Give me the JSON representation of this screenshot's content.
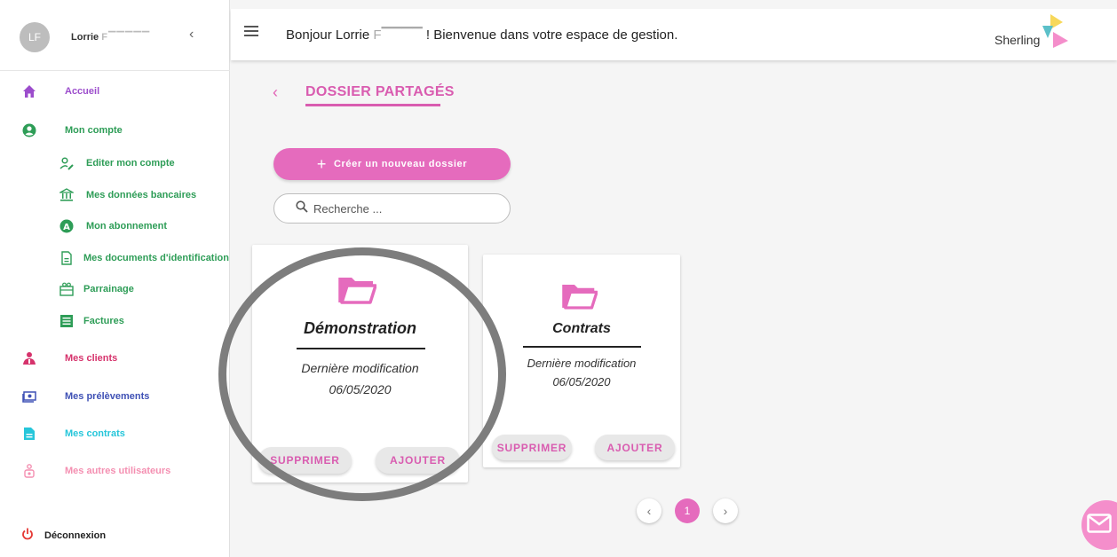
{
  "sidebar": {
    "avatar_initials": "LF",
    "user_first": "Lorrie",
    "user_last_redacted": "F▔▔▔▔▔",
    "collapse_icon": "chevron-left-icon",
    "items": [
      {
        "label": "Accueil",
        "icon": "home-icon",
        "color": "#9c4dcc"
      },
      {
        "label": "Mon compte",
        "icon": "account-circle-icon",
        "color": "#2e9d57"
      },
      {
        "label": "Editer mon compte",
        "icon": "user-edit-icon",
        "color": "#2e9d57"
      },
      {
        "label": "Mes données bancaires",
        "icon": "bank-icon",
        "color": "#2e9d57"
      },
      {
        "label": "Mon abonnement",
        "icon": "subscription-icon",
        "color": "#2e9d57"
      },
      {
        "label": "Mes documents d'identification",
        "icon": "document-icon",
        "color": "#2e9d57"
      },
      {
        "label": "Parrainage",
        "icon": "gift-icon",
        "color": "#2e9d57"
      },
      {
        "label": "Factures",
        "icon": "invoice-icon",
        "color": "#2e9d57"
      },
      {
        "label": "Mes clients",
        "icon": "clients-icon",
        "color": "#d6336c"
      },
      {
        "label": "Mes prélèvements",
        "icon": "payment-icon",
        "color": "#3f51b5"
      },
      {
        "label": "Mes contrats",
        "icon": "contract-icon",
        "color": "#26c6da"
      },
      {
        "label": "Mes autres utilisateurs",
        "icon": "users-icon",
        "color": "#f48fb1"
      }
    ],
    "logout_label": "Déconnexion"
  },
  "header": {
    "greeting_start": "Bonjour Lorrie ",
    "greeting_redacted": "F▔▔▔▔",
    "greeting_end": " ! Bienvenue dans votre espace de gestion.",
    "logo_text": "Sherling"
  },
  "main": {
    "title": "DOSSIER PARTAGÉS",
    "create_button": "Créer un nouveau dossier",
    "search_placeholder": "Recherche ...",
    "folders": [
      {
        "name": "Démonstration",
        "meta_label": "Dernière modification",
        "date": "06/05/2020",
        "delete_label": "SUPPRIMER",
        "add_label": "AJOUTER"
      },
      {
        "name": "Contrats",
        "meta_label": "Dernière modification",
        "date": "06/05/2020",
        "delete_label": "SUPPRIMER",
        "add_label": "AJOUTER"
      }
    ],
    "pagination": {
      "current": "1"
    }
  },
  "colors": {
    "accent": "#e56bbd",
    "title": "#d95cb0"
  }
}
